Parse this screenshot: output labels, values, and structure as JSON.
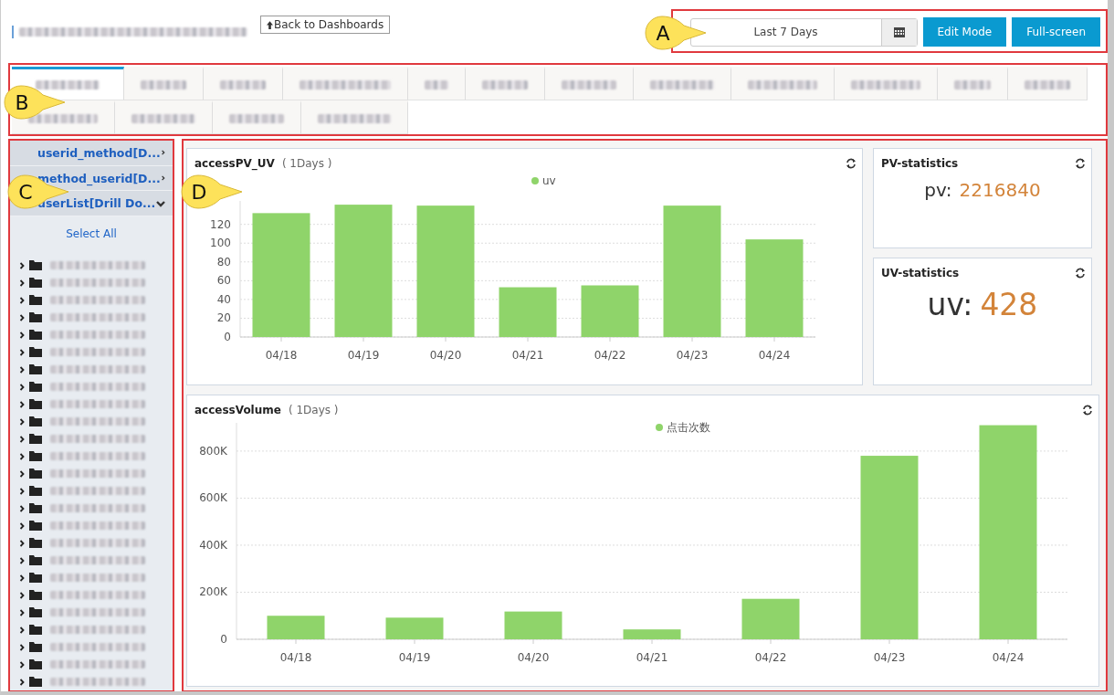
{
  "header": {
    "back_button": "Back to Dashboards",
    "date_range": "Last 7 Days",
    "buttons": [
      "Edit Mode",
      "Full-screen"
    ]
  },
  "tabs": [
    {
      "selected": true
    },
    {
      "selected": false
    },
    {
      "selected": false
    },
    {
      "selected": false
    },
    {
      "selected": false
    },
    {
      "selected": false
    },
    {
      "selected": false
    },
    {
      "selected": false
    },
    {
      "selected": false
    },
    {
      "selected": false
    },
    {
      "selected": false
    },
    {
      "selected": false
    },
    {
      "selected": false
    },
    {
      "selected": false
    },
    {
      "selected": false
    },
    {
      "selected": false
    }
  ],
  "sidebar": {
    "sections": [
      {
        "label": "userid_method[D...",
        "expanded": false
      },
      {
        "label": "method_userid[D...",
        "expanded": false
      },
      {
        "label": "userList[Drill Do...",
        "expanded": true,
        "select_all": "Select All",
        "items": [
          {
            "expanded": false
          },
          {
            "expanded": false
          },
          {
            "expanded": false
          },
          {
            "expanded": false
          },
          {
            "expanded": false
          },
          {
            "expanded": false
          },
          {
            "expanded": false
          },
          {
            "expanded": false
          },
          {
            "expanded": false
          },
          {
            "expanded": false
          },
          {
            "expanded": false
          },
          {
            "expanded": false
          },
          {
            "expanded": false
          },
          {
            "expanded": false
          },
          {
            "expanded": false
          },
          {
            "expanded": false
          },
          {
            "expanded": false
          },
          {
            "expanded": false
          },
          {
            "expanded": false
          },
          {
            "expanded": false
          },
          {
            "expanded": false
          },
          {
            "expanded": false
          },
          {
            "expanded": false
          },
          {
            "expanded": false
          },
          {
            "expanded": false
          }
        ]
      }
    ]
  },
  "widgets": [
    {
      "kind": "chart",
      "title": "accessPV_UV",
      "period": "( 1Days )",
      "chart_data": {
        "type": "bar",
        "categories": [
          "04/18",
          "04/19",
          "04/20",
          "04/21",
          "04/22",
          "04/23",
          "04/24"
        ],
        "series": [
          {
            "name": "uv",
            "color": "#8fd46a",
            "values": [
              132,
              141,
              140,
              53,
              55,
              140,
              104
            ]
          }
        ],
        "grid": true,
        "ylim": [
          0,
          145
        ],
        "yticks": [
          0,
          20,
          40,
          60,
          80,
          100,
          120
        ]
      }
    },
    {
      "kind": "stat",
      "title": "PV-statistics",
      "name": "pv:",
      "value": "2216840"
    },
    {
      "kind": "stat",
      "title": "UV-statistics",
      "name": "uv:",
      "value": "428"
    },
    {
      "kind": "chart",
      "title": "accessVolume",
      "period": "( 1Days )",
      "chart_data": {
        "type": "bar",
        "categories": [
          "04/18",
          "04/19",
          "04/20",
          "04/21",
          "04/22",
          "04/23",
          "04/24"
        ],
        "series": [
          {
            "name": "点击次数",
            "color": "#8fd46a",
            "values": [
              100000,
              92000,
              118000,
              42000,
              172000,
              780000,
              910000
            ]
          }
        ],
        "grid": true,
        "ylim": [
          0,
          920000
        ],
        "yticks": [
          {
            "value": 0,
            "label": "0"
          },
          {
            "value": 200000,
            "label": "200K"
          },
          {
            "value": 400000,
            "label": "400K"
          },
          {
            "value": 600000,
            "label": "600K"
          },
          {
            "value": 800000,
            "label": "800K"
          }
        ]
      }
    }
  ],
  "annotations": [
    {
      "label": "A"
    },
    {
      "label": "B"
    },
    {
      "label": "C"
    },
    {
      "label": "D"
    }
  ]
}
